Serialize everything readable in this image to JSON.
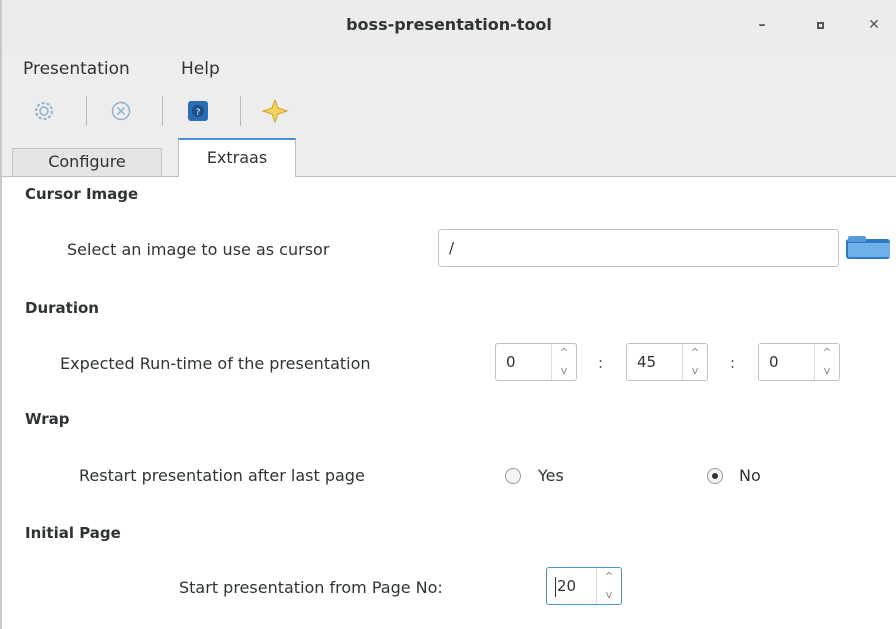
{
  "window": {
    "title": "boss-presentation-tool",
    "minimize_glyph": "–",
    "maximize_glyph": "▫",
    "close_glyph": "✕"
  },
  "menubar": {
    "items": [
      "Presentation",
      "Help"
    ]
  },
  "toolbar": {
    "icons": [
      "gear-icon",
      "close-circle-icon",
      "help-icon",
      "star-icon"
    ],
    "accent": "#2a6db3"
  },
  "tabs": [
    {
      "label": "Configure",
      "active": false
    },
    {
      "label": "Extraas",
      "active": true
    }
  ],
  "cursor_image": {
    "title": "Cursor Image",
    "label": "Select an image to use as cursor",
    "value": "/"
  },
  "duration": {
    "title": "Duration",
    "label": "Expected Run-time of the presentation",
    "hours": "0",
    "minutes": "45",
    "seconds": "0",
    "separator": ":"
  },
  "wrap": {
    "title": "Wrap",
    "label": "Restart presentation after last page",
    "option_yes": "Yes",
    "option_no": "No",
    "selected": "No"
  },
  "initial_page": {
    "title": "Initial Page",
    "label": "Start presentation from Page No:",
    "value": "20"
  },
  "spin_arrows": {
    "up": "^",
    "down": "v"
  }
}
